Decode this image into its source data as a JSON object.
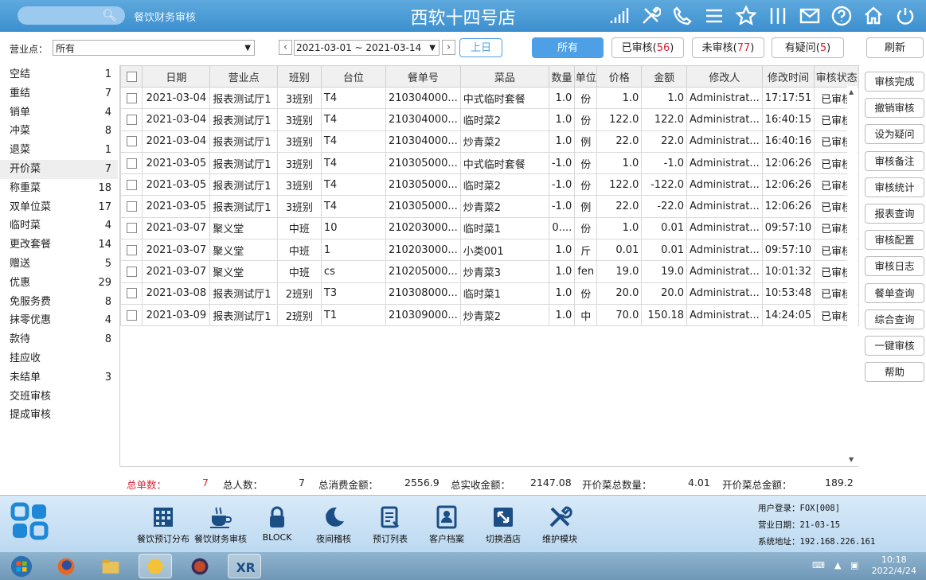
{
  "header": {
    "search_placeholder": "",
    "module_name": "餐饮财务审核",
    "store_title": "西软十四号店"
  },
  "filter": {
    "outlet_label": "营业点：",
    "outlet_value": "所有",
    "date_range": "2021-03-01 ~ 2021-03-14",
    "prev_day": "上日",
    "tab_all": "所有",
    "tab_audited": "已审核(",
    "tab_audited_count": "56",
    "tab_unaudited": "未审核(",
    "tab_unaudited_count": "77",
    "tab_doubtful": "有疑问(",
    "tab_doubtful_count": "5",
    "close_paren": ")",
    "refresh": "刷新"
  },
  "sidebar": {
    "items": [
      {
        "label": "空结",
        "count": "1"
      },
      {
        "label": "重结",
        "count": "7"
      },
      {
        "label": "销单",
        "count": "4"
      },
      {
        "label": "冲菜",
        "count": "8"
      },
      {
        "label": "退菜",
        "count": "1"
      },
      {
        "label": "开价菜",
        "count": "7"
      },
      {
        "label": "称重菜",
        "count": "18"
      },
      {
        "label": "双单位菜",
        "count": "17"
      },
      {
        "label": "临时菜",
        "count": "4"
      },
      {
        "label": "更改套餐",
        "count": "14"
      },
      {
        "label": "赠送",
        "count": "5"
      },
      {
        "label": "优惠",
        "count": "29"
      },
      {
        "label": "免服务费",
        "count": "8"
      },
      {
        "label": "抹零优惠",
        "count": "4"
      },
      {
        "label": "款待",
        "count": "8"
      },
      {
        "label": "挂应收",
        "count": ""
      },
      {
        "label": "未结单",
        "count": "3"
      },
      {
        "label": "交班审核",
        "count": ""
      },
      {
        "label": "提成审核",
        "count": ""
      }
    ]
  },
  "table": {
    "columns": [
      "日期",
      "营业点",
      "班别",
      "台位",
      "餐单号",
      "菜品",
      "数量",
      "单位",
      "价格",
      "金额",
      "修改人",
      "修改时间",
      "审核状态"
    ],
    "rows": [
      [
        "2021-03-04",
        "报表测试厅1",
        "3班别",
        "T4",
        "210304000...",
        "中式临时套餐",
        "1.0",
        "份",
        "1.0",
        "1.0",
        "Administrat...",
        "17:17:51",
        "已审核"
      ],
      [
        "2021-03-04",
        "报表测试厅1",
        "3班别",
        "T4",
        "210304000...",
        "临时菜2",
        "1.0",
        "份",
        "122.0",
        "122.0",
        "Administrat...",
        "16:40:15",
        "已审核"
      ],
      [
        "2021-03-04",
        "报表测试厅1",
        "3班别",
        "T4",
        "210304000...",
        "炒青菜2",
        "1.0",
        "例",
        "22.0",
        "22.0",
        "Administrat...",
        "16:40:16",
        "已审核"
      ],
      [
        "2021-03-05",
        "报表测试厅1",
        "3班别",
        "T4",
        "210305000...",
        "中式临时套餐",
        "-1.0",
        "份",
        "1.0",
        "-1.0",
        "Administrat...",
        "12:06:26",
        "已审核"
      ],
      [
        "2021-03-05",
        "报表测试厅1",
        "3班别",
        "T4",
        "210305000...",
        "临时菜2",
        "-1.0",
        "份",
        "122.0",
        "-122.0",
        "Administrat...",
        "12:06:26",
        "已审核"
      ],
      [
        "2021-03-05",
        "报表测试厅1",
        "3班别",
        "T4",
        "210305000...",
        "炒青菜2",
        "-1.0",
        "例",
        "22.0",
        "-22.0",
        "Administrat...",
        "12:06:26",
        "已审核"
      ],
      [
        "2021-03-07",
        "聚义堂",
        "中班",
        "10",
        "210203000...",
        "临时菜1",
        "0....",
        "份",
        "1.0",
        "0.01",
        "Administrat...",
        "09:57:10",
        "已审核"
      ],
      [
        "2021-03-07",
        "聚义堂",
        "中班",
        "1",
        "210203000...",
        "小类001",
        "1.0",
        "斤",
        "0.01",
        "0.01",
        "Administrat...",
        "09:57:10",
        "已审核"
      ],
      [
        "2021-03-07",
        "聚义堂",
        "中班",
        "cs",
        "210205000...",
        "炒青菜3",
        "1.0",
        "fen",
        "19.0",
        "19.0",
        "Administrat...",
        "10:01:32",
        "已审核"
      ],
      [
        "2021-03-08",
        "报表测试厅1",
        "2班别",
        "T3",
        "210308000...",
        "临时菜1",
        "1.0",
        "份",
        "20.0",
        "20.0",
        "Administrat...",
        "10:53:48",
        "已审核"
      ],
      [
        "2021-03-09",
        "报表测试厅1",
        "2班别",
        "T1",
        "210309000...",
        "炒青菜2",
        "1.0",
        "中",
        "70.0",
        "150.18",
        "Administrat...",
        "14:24:05",
        "已审核"
      ]
    ]
  },
  "totals": {
    "order_count_label": "总单数：",
    "order_count": "7",
    "guest_count_label": "总人数：",
    "guest_count": "7",
    "consume_label": "总消费金额：",
    "consume": "2556.9",
    "actual_label": "总实收金额：",
    "actual": "2147.08",
    "open_qty_label": "开价菜总数量：",
    "open_qty": "4.01",
    "open_amount_label": "开价菜总金额：",
    "open_amount": "189.2"
  },
  "actions": [
    "审核完成",
    "撤销审核",
    "设为疑问",
    "审核备注",
    "审核统计",
    "报表查询",
    "审核配置",
    "审核日志",
    "餐单查询",
    "综合查询",
    "一键审核",
    "帮助"
  ],
  "modules": [
    {
      "label": "餐饮预订分布",
      "icon": "grid-calendar-icon"
    },
    {
      "label": "餐饮财务审核",
      "icon": "coffee-cup-icon"
    },
    {
      "label": "BLOCK",
      "icon": "lock-icon"
    },
    {
      "label": "夜间稽核",
      "icon": "moon-icon"
    },
    {
      "label": "预订列表",
      "icon": "clipboard-icon"
    },
    {
      "label": "客户档案",
      "icon": "contact-card-icon"
    },
    {
      "label": "切换酒店",
      "icon": "switch-icon"
    },
    {
      "label": "维护模块",
      "icon": "tools-icon"
    }
  ],
  "sysinfo": {
    "user": "用户登录：FOX[008]",
    "biz_date": "营业日期：21-03-15",
    "address": "系统地址：192.168.226.161"
  },
  "taskbar": {
    "time": "10:18",
    "date": "2022/4/24"
  },
  "colors": {
    "header": "#4b9ad6",
    "accent": "#4ea0e6",
    "count_red": "#dd2233"
  }
}
